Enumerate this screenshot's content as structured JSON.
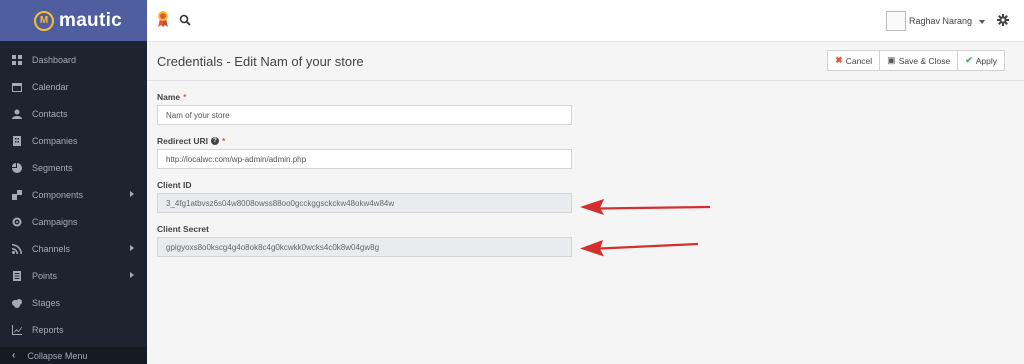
{
  "app": {
    "logo_text": "mautic"
  },
  "sidebar": {
    "items": [
      {
        "label": "Dashboard",
        "icon": "dashboard-icon",
        "has_submenu": false
      },
      {
        "label": "Calendar",
        "icon": "calendar-icon",
        "has_submenu": false
      },
      {
        "label": "Contacts",
        "icon": "contacts-icon",
        "has_submenu": false
      },
      {
        "label": "Companies",
        "icon": "companies-icon",
        "has_submenu": false
      },
      {
        "label": "Segments",
        "icon": "segments-icon",
        "has_submenu": false
      },
      {
        "label": "Components",
        "icon": "components-icon",
        "has_submenu": true
      },
      {
        "label": "Campaigns",
        "icon": "campaigns-icon",
        "has_submenu": false
      },
      {
        "label": "Channels",
        "icon": "channels-icon",
        "has_submenu": true
      },
      {
        "label": "Points",
        "icon": "points-icon",
        "has_submenu": true
      },
      {
        "label": "Stages",
        "icon": "stages-icon",
        "has_submenu": false
      },
      {
        "label": "Reports",
        "icon": "reports-icon",
        "has_submenu": false
      }
    ],
    "collapse_label": "Collapse Menu"
  },
  "topbar": {
    "user_name": "Raghav Narang"
  },
  "page": {
    "title": "Credentials - Edit Nam of your store"
  },
  "actions": {
    "cancel": "Cancel",
    "save_close": "Save & Close",
    "apply": "Apply"
  },
  "form": {
    "name": {
      "label": "Name",
      "value": "Nam of your store"
    },
    "redirect_uri": {
      "label": "Redirect URI",
      "value": "http://localwc.com/wp-admin/admin.php"
    },
    "client_id": {
      "label": "Client ID",
      "value": "3_4fg1atbvsz6s04w8008owss88oo0gcckggsckckw48okw4w84w"
    },
    "client_secret": {
      "label": "Client Secret",
      "value": "gpigyoxs8o0kscg4g4o8ok8c4g0kcwkk0wcks4c0k8w04gw8g"
    }
  },
  "colors": {
    "sidebar_bg": "#1d2430",
    "logo_bg": "#4e5e9e",
    "accent": "#fdb933",
    "arrow": "#d32f2f"
  }
}
